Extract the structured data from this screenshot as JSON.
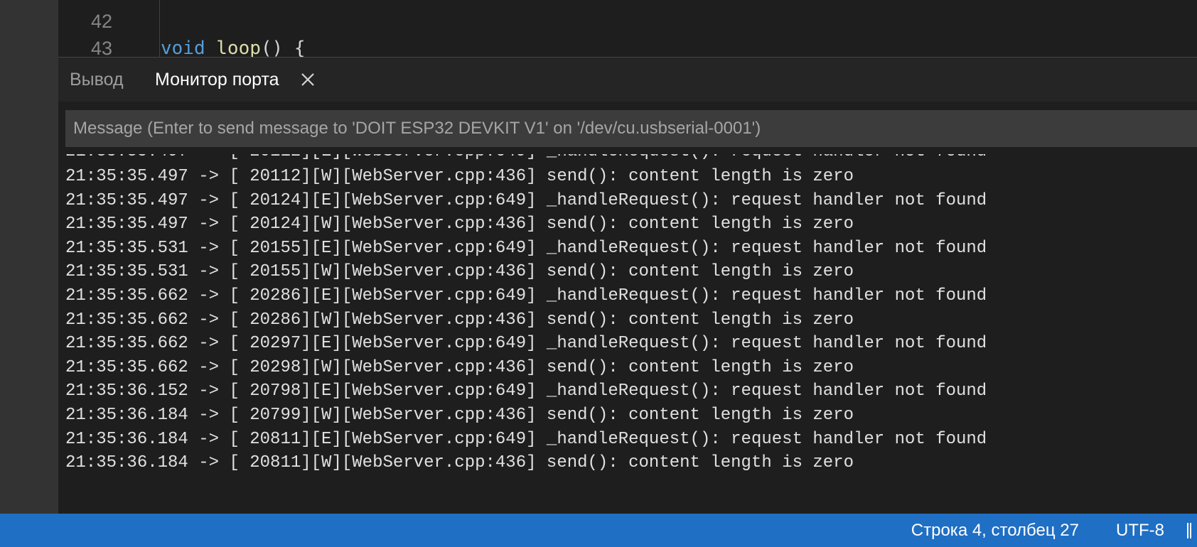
{
  "editor": {
    "line_numbers": [
      "42",
      "43"
    ],
    "code_line_43": {
      "keyword": "void",
      "function": "loop",
      "punct": "() {"
    }
  },
  "panel": {
    "tabs": [
      {
        "label": "Вывод",
        "active": false
      },
      {
        "label": "Монитор порта",
        "active": true
      }
    ],
    "close_icon": "close-icon"
  },
  "message": {
    "placeholder": "Message (Enter to send message to 'DOIT ESP32 DEVKIT V1' on '/dev/cu.usbserial-0001')",
    "value": ""
  },
  "log": {
    "lines": [
      "21:35:35.497 -> [ 20112][W][WebServer.cpp:436] send(): content length is zero",
      "21:35:35.497 -> [ 20124][E][WebServer.cpp:649] _handleRequest(): request handler not found",
      "21:35:35.497 -> [ 20124][W][WebServer.cpp:436] send(): content length is zero",
      "21:35:35.531 -> [ 20155][E][WebServer.cpp:649] _handleRequest(): request handler not found",
      "21:35:35.531 -> [ 20155][W][WebServer.cpp:436] send(): content length is zero",
      "21:35:35.662 -> [ 20286][E][WebServer.cpp:649] _handleRequest(): request handler not found",
      "21:35:35.662 -> [ 20286][W][WebServer.cpp:436] send(): content length is zero",
      "21:35:35.662 -> [ 20297][E][WebServer.cpp:649] _handleRequest(): request handler not found",
      "21:35:35.662 -> [ 20298][W][WebServer.cpp:436] send(): content length is zero",
      "21:35:36.152 -> [ 20798][E][WebServer.cpp:649] _handleRequest(): request handler not found",
      "21:35:36.184 -> [ 20799][W][WebServer.cpp:436] send(): content length is zero",
      "21:35:36.184 -> [ 20811][E][WebServer.cpp:649] _handleRequest(): request handler not found",
      "21:35:36.184 -> [ 20811][W][WebServer.cpp:436] send(): content length is zero"
    ]
  },
  "status_bar": {
    "position": "Строка 4, столбец 27",
    "encoding": "UTF-8"
  },
  "colors": {
    "status_bar": "#1f6fc4",
    "editor_bg": "#1e1e1e",
    "keyword": "#569cd6",
    "function": "#dcdcaa"
  }
}
